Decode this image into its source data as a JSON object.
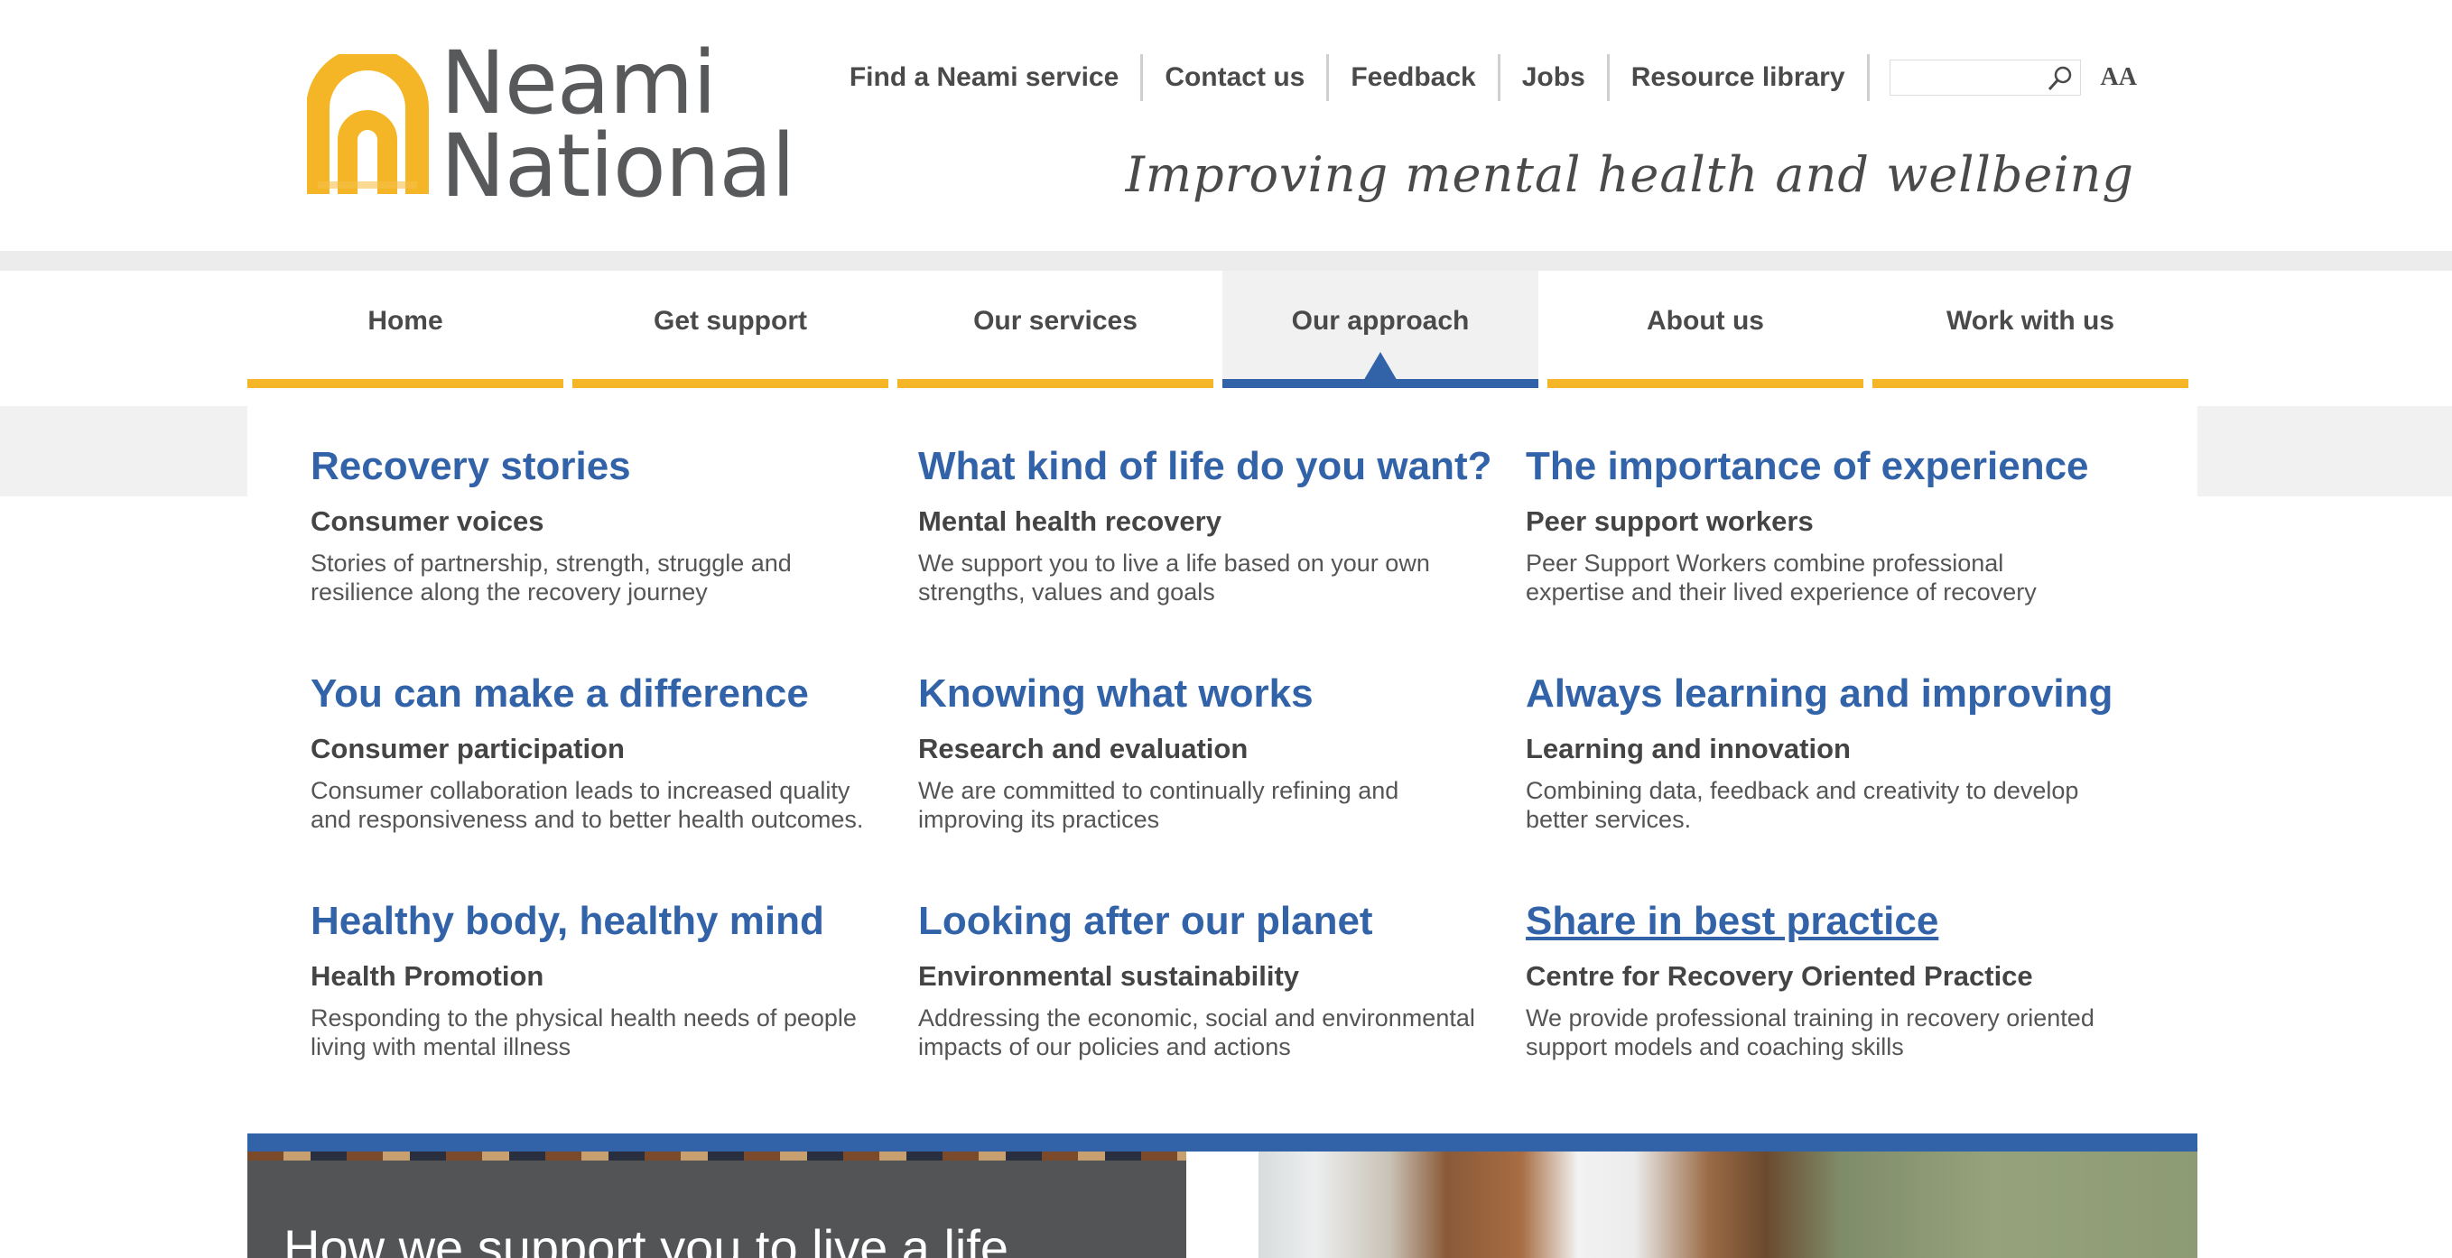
{
  "brand": {
    "line1": "Neami",
    "line2": "National",
    "tagline": "Improving mental health and wellbeing"
  },
  "topnav": {
    "links": [
      "Find a Neami service",
      "Contact us",
      "Feedback",
      "Jobs",
      "Resource library"
    ],
    "text_size_label": "AA"
  },
  "mainnav": {
    "tabs": [
      "Home",
      "Get support",
      "Our services",
      "Our approach",
      "About us",
      "Work with us"
    ],
    "active": "Our approach"
  },
  "dropdown": {
    "items": [
      {
        "title": "Recovery stories",
        "subtitle": "Consumer voices",
        "desc": "Stories of partnership, strength, struggle and resilience along the recovery journey"
      },
      {
        "title": "What kind of life do you want?",
        "subtitle": "Mental health recovery",
        "desc": "We support you to live a life based on your own strengths, values and goals"
      },
      {
        "title": "The importance of experience",
        "subtitle": "Peer support workers",
        "desc": "Peer Support Workers combine professional expertise and their lived experience of recovery"
      },
      {
        "title": "You can make a difference",
        "subtitle": "Consumer participation",
        "desc": "Consumer collaboration leads to increased quality and responsiveness and to better health outcomes."
      },
      {
        "title": "Knowing what works",
        "subtitle": "Research and evaluation",
        "desc": "We are committed to continually refining and improving its practices"
      },
      {
        "title": "Always learning and improving",
        "subtitle": "Learning and innovation",
        "desc": "Combining data, feedback and creativity to develop better services."
      },
      {
        "title": "Healthy body, healthy mind",
        "subtitle": "Health Promotion",
        "desc": "Responding to the physical health needs of people living with mental illness"
      },
      {
        "title": "Looking after our planet",
        "subtitle": "Environmental sustainability",
        "desc": "Addressing the economic, social and environmental impacts of our policies and actions"
      },
      {
        "title": "Share in best practice",
        "subtitle": "Centre for Recovery Oriented Practice",
        "desc": "We provide professional training in recovery oriented support models and coaching skills"
      }
    ]
  },
  "feature": {
    "headline": "How we support you to live a life"
  },
  "colors": {
    "accent_blue": "#3263a8",
    "accent_yellow": "#f4b526",
    "text_grey": "#4a4a4a"
  }
}
